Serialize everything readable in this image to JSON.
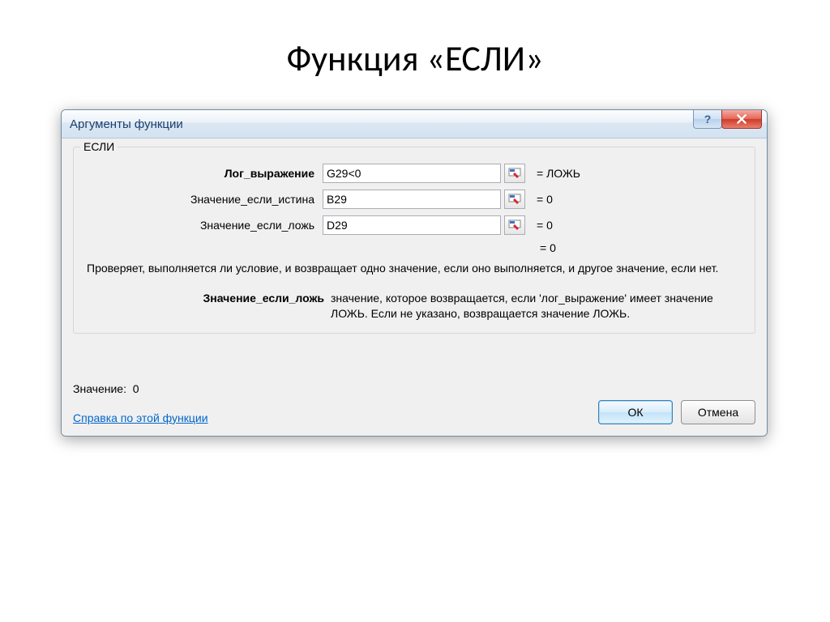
{
  "slide": {
    "title": "Функция «ЕСЛИ»"
  },
  "dialog": {
    "title": "Аргументы функции",
    "function_name": "ЕСЛИ",
    "args": [
      {
        "label": "Лог_выражение",
        "bold": true,
        "value": "G29<0",
        "result": "=  ЛОЖЬ"
      },
      {
        "label": "Значение_если_истина",
        "bold": false,
        "value": "B29",
        "result": "=  0"
      },
      {
        "label": "Значение_если_ложь",
        "bold": false,
        "value": "D29",
        "result": "=  0"
      }
    ],
    "overall_result": "=  0",
    "description": "Проверяет, выполняется ли условие, и возвращает одно значение, если оно выполняется, и другое значение, если нет.",
    "detail_label": "Значение_если_ложь",
    "detail_text": "значение, которое возвращается, если 'лог_выражение' имеет значение ЛОЖЬ. Если не указано, возвращается значение ЛОЖЬ.",
    "result_label": "Значение:",
    "result_value": "0",
    "help_link": "Справка по этой функции",
    "buttons": {
      "ok": "ОК",
      "cancel": "Отмена"
    }
  }
}
